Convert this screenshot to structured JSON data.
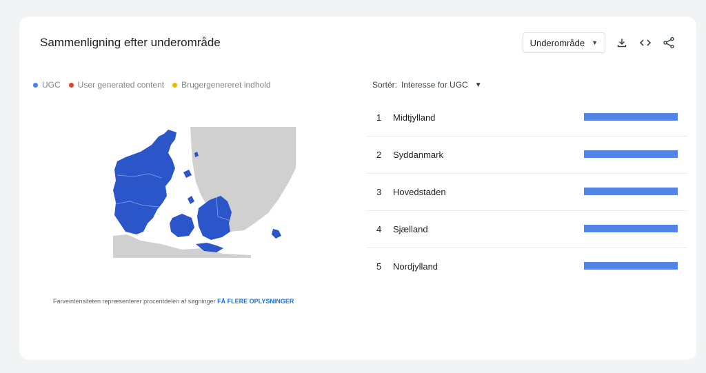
{
  "header": {
    "title": "Sammenligning efter underområde",
    "dropdown_label": "Underområde"
  },
  "icons": [
    "download-icon",
    "embed-code-icon",
    "share-icon"
  ],
  "legend": [
    {
      "label": "UGC",
      "color": "#4285f4"
    },
    {
      "label": "User generated content",
      "color": "#db4437"
    },
    {
      "label": "Brugergenereret indhold",
      "color": "#f4b400"
    }
  ],
  "sort": {
    "label": "Sortér:",
    "value": "Interesse for UGC"
  },
  "regions": [
    {
      "rank": "1",
      "name": "Midtjylland",
      "value": 100
    },
    {
      "rank": "2",
      "name": "Syddanmark",
      "value": 100
    },
    {
      "rank": "3",
      "name": "Hovedstaden",
      "value": 100
    },
    {
      "rank": "4",
      "name": "Sjælland",
      "value": 100
    },
    {
      "rank": "5",
      "name": "Nordjylland",
      "value": 100
    }
  ],
  "colors": {
    "map_fill": "#2b56c9",
    "map_background_land": "#d0d0d0",
    "bar": "#5284e8",
    "link": "#1a73e8"
  },
  "caption": {
    "text": "Farveintensiteten repræsenterer procentdelen af søgninger",
    "link": "FÅ FLERE OPLYSNINGER"
  }
}
